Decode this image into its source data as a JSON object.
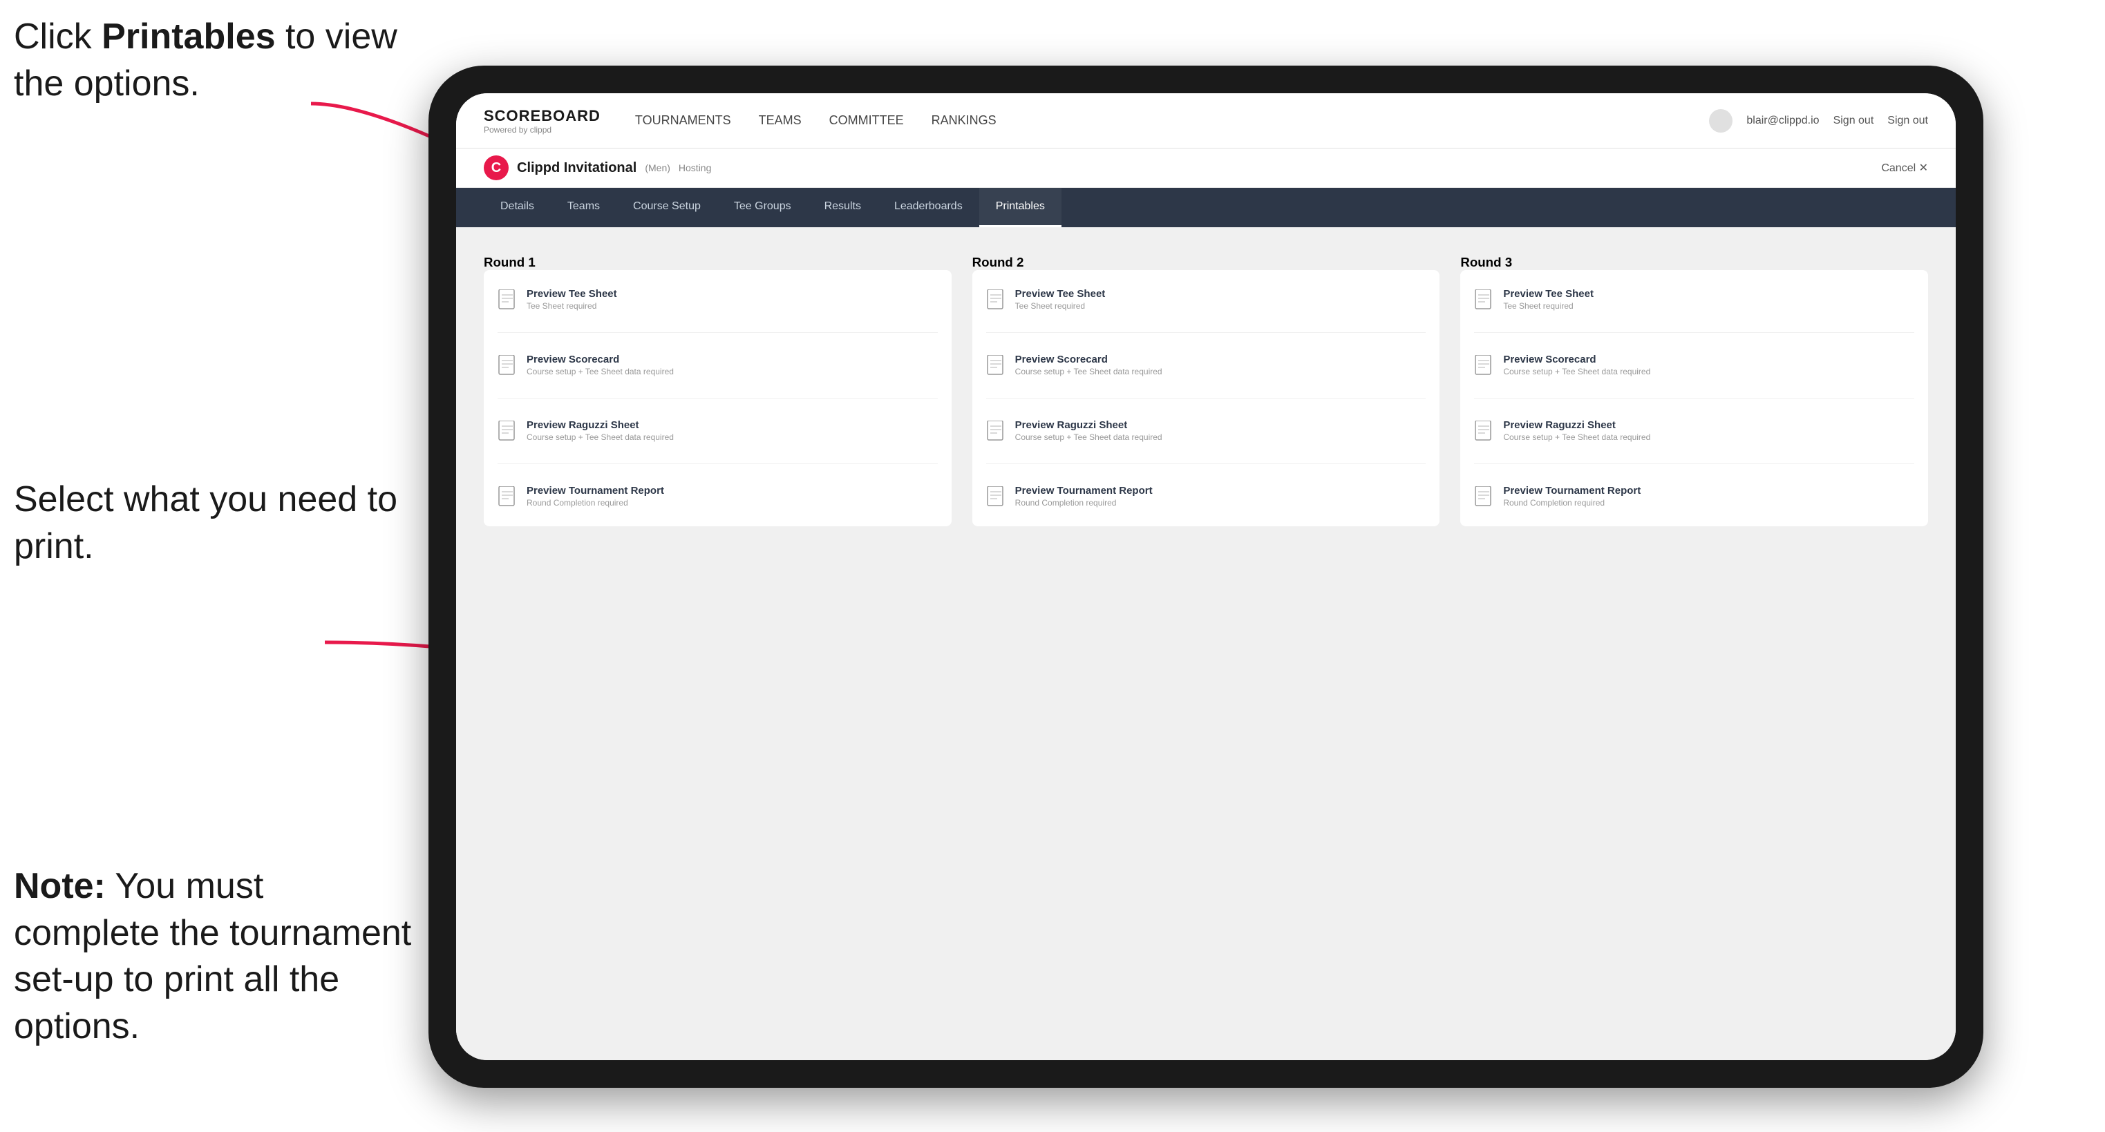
{
  "annotations": {
    "top": "Click Printables to view the options.",
    "top_bold": "Printables",
    "middle": "Select what you need to print.",
    "bottom_bold": "Note:",
    "bottom": " You must complete the tournament set-up to print all the options."
  },
  "nav": {
    "logo": "SCOREBOARD",
    "powered": "Powered by clippd",
    "links": [
      "TOURNAMENTS",
      "TEAMS",
      "COMMITTEE",
      "RANKINGS"
    ],
    "user_email": "blair@clippd.io",
    "sign_out": "Sign out"
  },
  "tournament_bar": {
    "initial": "C",
    "name": "Clippd Invitational",
    "gender": "(Men)",
    "status": "Hosting",
    "cancel": "Cancel ✕"
  },
  "sub_nav": {
    "items": [
      "Details",
      "Teams",
      "Course Setup",
      "Tee Groups",
      "Results",
      "Leaderboards",
      "Printables"
    ],
    "active": "Printables"
  },
  "rounds": [
    {
      "label": "Round 1",
      "items": [
        {
          "title": "Preview Tee Sheet",
          "subtitle": "Tee Sheet required"
        },
        {
          "title": "Preview Scorecard",
          "subtitle": "Course setup + Tee Sheet data required"
        },
        {
          "title": "Preview Raguzzi Sheet",
          "subtitle": "Course setup + Tee Sheet data required"
        },
        {
          "title": "Preview Tournament Report",
          "subtitle": "Round Completion required"
        }
      ]
    },
    {
      "label": "Round 2",
      "items": [
        {
          "title": "Preview Tee Sheet",
          "subtitle": "Tee Sheet required"
        },
        {
          "title": "Preview Scorecard",
          "subtitle": "Course setup + Tee Sheet data required"
        },
        {
          "title": "Preview Raguzzi Sheet",
          "subtitle": "Course setup + Tee Sheet data required"
        },
        {
          "title": "Preview Tournament Report",
          "subtitle": "Round Completion required"
        }
      ]
    },
    {
      "label": "Round 3",
      "items": [
        {
          "title": "Preview Tee Sheet",
          "subtitle": "Tee Sheet required"
        },
        {
          "title": "Preview Scorecard",
          "subtitle": "Course setup + Tee Sheet data required"
        },
        {
          "title": "Preview Raguzzi Sheet",
          "subtitle": "Course setup + Tee Sheet data required"
        },
        {
          "title": "Preview Tournament Report",
          "subtitle": "Round Completion required"
        }
      ]
    }
  ]
}
